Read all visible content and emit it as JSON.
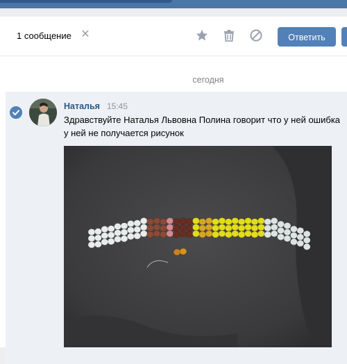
{
  "toolbar": {
    "message_count": "1 сообщение",
    "close_icon": "close-icon",
    "star_icon": "star-icon",
    "delete_icon": "trash-icon",
    "spam_icon": "block-icon",
    "reply_label": "Ответить"
  },
  "date_separator": "сегодня",
  "message": {
    "author": "Наталья",
    "time": "15:45",
    "text": "Здравствуйте Наталья Львовна Полина говорит что у ней ошибка у ней не получается рисунок",
    "attachment": "photo"
  },
  "colors": {
    "accent": "#5181b8",
    "link": "#2a5885",
    "header": "#4a76a8",
    "selected_bg": "#edf0f5"
  }
}
